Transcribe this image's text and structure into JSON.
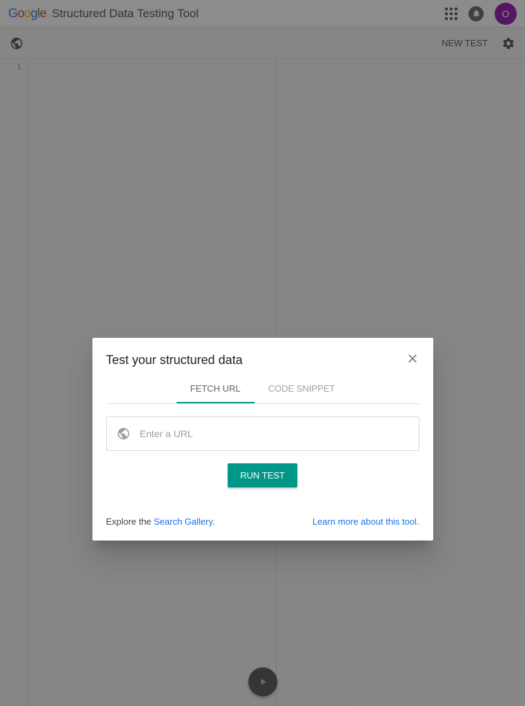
{
  "header": {
    "title": "Structured Data Testing Tool",
    "avatar_initial": "O"
  },
  "toolbar": {
    "new_test_label": "NEW TEST"
  },
  "editor": {
    "line_number": "1"
  },
  "modal": {
    "title": "Test your structured data",
    "tabs": {
      "fetch_url": "FETCH URL",
      "code_snippet": "CODE SNIPPET"
    },
    "url_placeholder": "Enter a URL",
    "run_button": "RUN TEST",
    "footer": {
      "explore_prefix": "Explore the ",
      "explore_link": "Search Gallery",
      "explore_suffix": ".",
      "learn_more": "Learn more about this tool."
    }
  }
}
